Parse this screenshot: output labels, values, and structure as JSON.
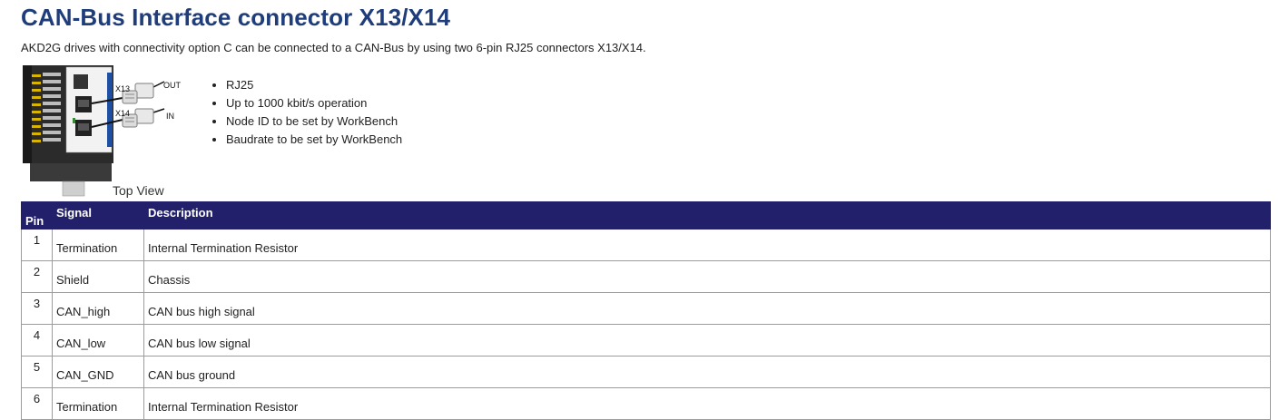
{
  "title": "CAN-Bus Interface connector X13/X14",
  "intro": "AKD2G drives with connectivity option C can be connected to a CAN-Bus by using two 6-pin RJ25 connectors X13/X14.",
  "figure": {
    "labels": {
      "x13": "X13",
      "x14": "X14",
      "out": "OUT",
      "in": "IN"
    },
    "caption": "Top View"
  },
  "features": [
    "RJ25",
    "Up to 1000 kbit/s operation",
    "Node ID to be set by WorkBench",
    "Baudrate to be set by WorkBench"
  ],
  "table": {
    "headers": {
      "pin": "Pin",
      "signal": "Signal",
      "description": "Description"
    },
    "rows": [
      {
        "pin": "1",
        "signal": "Termination",
        "description": "Internal Termination Resistor"
      },
      {
        "pin": "2",
        "signal": "Shield",
        "description": "Chassis"
      },
      {
        "pin": "3",
        "signal": "CAN_high",
        "description": "CAN bus high signal"
      },
      {
        "pin": "4",
        "signal": "CAN_low",
        "description": "CAN bus low signal"
      },
      {
        "pin": "5",
        "signal": "CAN_GND",
        "description": "CAN bus ground"
      },
      {
        "pin": "6",
        "signal": "Termination",
        "description": "Internal Termination Resistor"
      }
    ]
  },
  "colors": {
    "title": "#1f3d7a",
    "header_bg": "#23206b"
  }
}
